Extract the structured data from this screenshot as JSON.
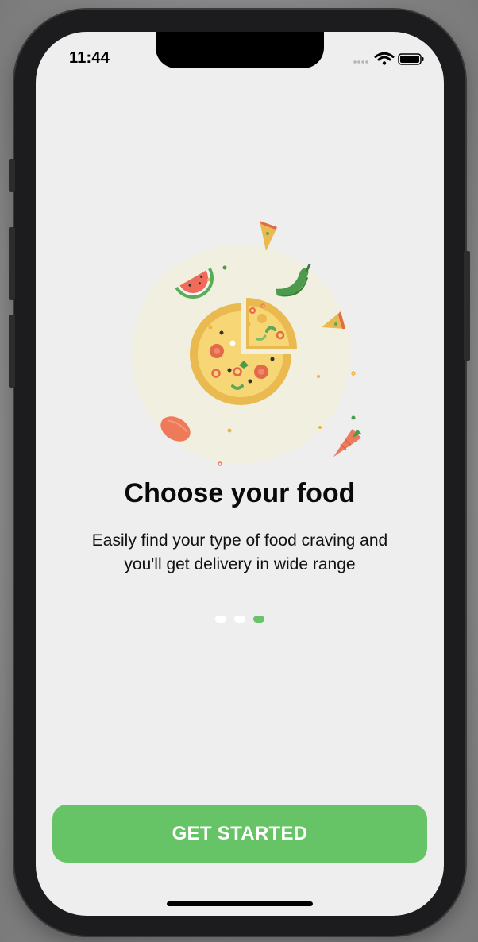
{
  "status_bar": {
    "time": "11:44",
    "signal_icon": "cellular-dots-icon",
    "wifi_icon": "wifi-icon",
    "battery_icon": "battery-icon"
  },
  "onboarding": {
    "illustration": "pizza-illustration",
    "title": "Choose your food",
    "subtitle_line1": "Easily find your type of food craving and",
    "subtitle_line2": "you'll get delivery in wide range",
    "page_count": 3,
    "active_page": 3
  },
  "cta": {
    "label": "GET STARTED",
    "color": "#66c466"
  },
  "colors": {
    "screen_bg": "#eeeeee",
    "accent": "#66c466",
    "text": "#0a0a0a"
  }
}
